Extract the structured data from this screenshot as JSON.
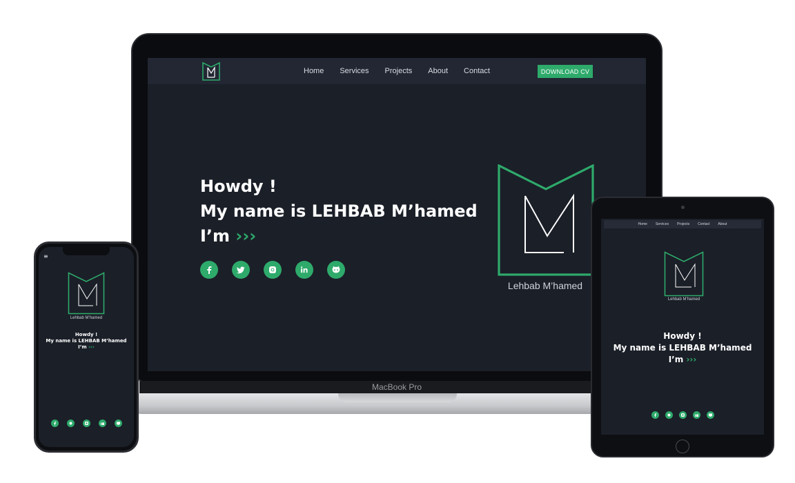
{
  "laptop": {
    "nav": {
      "links": [
        "Home",
        "Services",
        "Projects",
        "About",
        "Contact"
      ],
      "cta_label": "DOWNLOAD CV"
    },
    "hero": {
      "line1": "Howdy !",
      "line2": "My name is LEHBAB M’hamed",
      "line3_prefix": "I’m ",
      "line3_arrows": "›››"
    },
    "logo_caption": "Lehbab M’hamed",
    "device_label": "MacBook Pro",
    "socials": [
      "facebook-icon",
      "twitter-icon",
      "instagram-icon",
      "linkedin-icon",
      "github-icon"
    ]
  },
  "tablet": {
    "nav": {
      "links": [
        "Home",
        "Services",
        "Projects",
        "Contact",
        "About"
      ]
    },
    "logo_caption": "Lehbab M’hamed",
    "hero": {
      "line1": "Howdy !",
      "line2": "My name is LEHBAB M’hamed",
      "line3_prefix": "I’m ",
      "line3_arrows": "›››"
    }
  },
  "phone": {
    "menu_icon": "≡",
    "logo_caption": "Lehbab M’hamed",
    "hero": {
      "line1": "Howdy !",
      "line2": "My name is LEHBAB M’hamed",
      "line3_prefix": "I’m ",
      "line3_arrows": "›››"
    }
  },
  "colors": {
    "accent": "#2eaa6b",
    "screen_bg": "#1b1f28",
    "nav_bg": "#222733"
  }
}
